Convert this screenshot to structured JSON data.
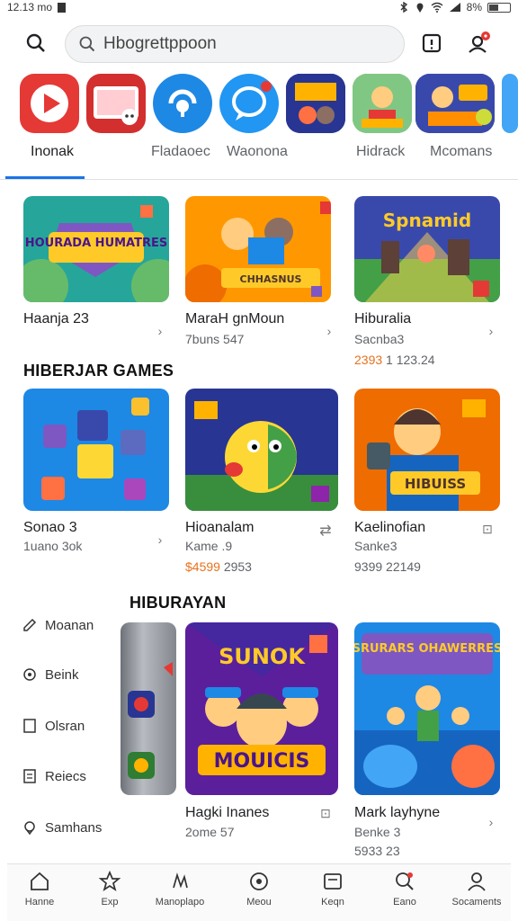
{
  "status_bar": {
    "time": "12.13 mo",
    "battery": "8%"
  },
  "search": {
    "placeholder": "Hbogrettppoon"
  },
  "tabs": [
    {
      "label": "Inonak"
    },
    {
      "label": "Fladaoec"
    },
    {
      "label": "Waonona"
    },
    {
      "label": "Hidrack"
    },
    {
      "label": "Mcomans"
    }
  ],
  "row1": [
    {
      "banner": "HOURADA HUMATRES",
      "title": "Haanja 23",
      "sub": "",
      "price": ""
    },
    {
      "banner": "CHHASNUS",
      "title": "MaraH gnMoun",
      "sub": "7buns 547",
      "price": ""
    },
    {
      "banner": "Spnamid",
      "title": "Hiburalia",
      "sub": "Sacnba3",
      "price_accent": "2393",
      "price": "1 123.24"
    }
  ],
  "section1": {
    "title": "HIBERJAR GAMES"
  },
  "row2": [
    {
      "title": "Sonao 3",
      "sub": "1uano 3ok",
      "price": ""
    },
    {
      "title": "Hioanalam",
      "sub": "Kame .9",
      "price_accent": "$4599",
      "price": "2953"
    },
    {
      "banner": "HIBUISS",
      "title": "Kaelinofian",
      "sub": "Sanke3",
      "price": "9399 22149"
    }
  ],
  "section2": {
    "title": "HIBURAYAN"
  },
  "side_menu": [
    {
      "label": "Moanan"
    },
    {
      "label": "Beink"
    },
    {
      "label": "Olsran"
    },
    {
      "label": "Reiecs"
    },
    {
      "label": "Samhans"
    }
  ],
  "row3": [
    {
      "banner_top": "SUNOK",
      "banner_bottom": "MOUICIS",
      "title": "Hagki Inanes",
      "sub": "2ome 57"
    },
    {
      "banner": "SRURARS OHAWERRES",
      "title": "Mark layhyne",
      "sub": "Benke 3",
      "price": "5933 23"
    }
  ],
  "bottom_nav": [
    {
      "label": "Hanne"
    },
    {
      "label": "Exp"
    },
    {
      "label": "Manoplapo"
    },
    {
      "label": "Meou"
    },
    {
      "label": "Keqn"
    },
    {
      "label": "Eano"
    },
    {
      "label": "Socaments"
    }
  ],
  "colors": {
    "accent": "#1a73e8",
    "price": "#e8711c",
    "notification": "#e53935"
  }
}
